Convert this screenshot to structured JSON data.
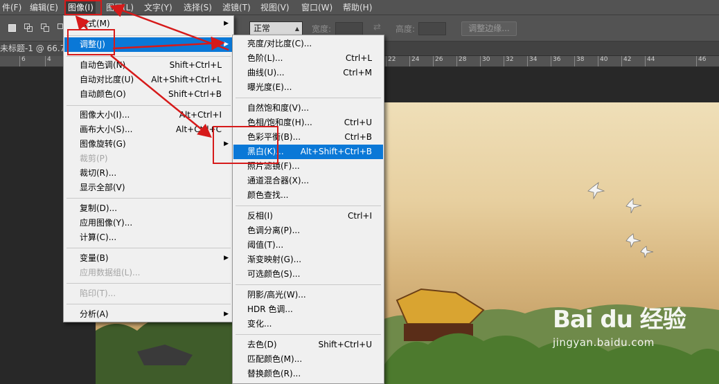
{
  "menubar": {
    "items": [
      "件(F)",
      "编辑(E)",
      "图像(I)",
      "图层(L)",
      "文字(Y)",
      "选择(S)",
      "滤镜(T)",
      "视图(V)",
      "窗口(W)",
      "帮助(H)"
    ]
  },
  "options": {
    "blend_mode": "正常",
    "width_label": "宽度:",
    "height_label": "高度:",
    "refine_edge": "调整边缘..."
  },
  "doc": {
    "tab": "未标题-1 @ 66.7%"
  },
  "ruler": {
    "labels": [
      "6",
      "4",
      "2",
      "22",
      "24",
      "26",
      "28",
      "30",
      "32",
      "34",
      "36",
      "38",
      "40",
      "42",
      "44",
      "46"
    ]
  },
  "image_menu": {
    "items": [
      {
        "label": "模式(M)",
        "shortcut": "",
        "submenu": true
      },
      {
        "label": "调整(J)",
        "shortcut": "",
        "submenu": true
      },
      {
        "label": "自动色调(N)",
        "shortcut": "Shift+Ctrl+L"
      },
      {
        "label": "自动对比度(U)",
        "shortcut": "Alt+Shift+Ctrl+L"
      },
      {
        "label": "自动颜色(O)",
        "shortcut": "Shift+Ctrl+B"
      },
      {
        "label": "图像大小(I)...",
        "shortcut": "Alt+Ctrl+I"
      },
      {
        "label": "画布大小(S)...",
        "shortcut": "Alt+Ctrl+C"
      },
      {
        "label": "图像旋转(G)",
        "shortcut": "",
        "submenu": true
      },
      {
        "label": "裁剪(P)",
        "shortcut": "",
        "disabled": true
      },
      {
        "label": "裁切(R)...",
        "shortcut": ""
      },
      {
        "label": "显示全部(V)",
        "shortcut": ""
      },
      {
        "label": "复制(D)...",
        "shortcut": ""
      },
      {
        "label": "应用图像(Y)...",
        "shortcut": ""
      },
      {
        "label": "计算(C)...",
        "shortcut": ""
      },
      {
        "label": "变量(B)",
        "shortcut": "",
        "submenu": true
      },
      {
        "label": "应用数据组(L)...",
        "shortcut": "",
        "disabled": true
      },
      {
        "label": "陷印(T)...",
        "shortcut": "",
        "disabled": true
      },
      {
        "label": "分析(A)",
        "shortcut": "",
        "submenu": true
      }
    ]
  },
  "adjust_menu": {
    "items": [
      {
        "label": "亮度/对比度(C)...",
        "shortcut": ""
      },
      {
        "label": "色阶(L)...",
        "shortcut": "Ctrl+L"
      },
      {
        "label": "曲线(U)...",
        "shortcut": "Ctrl+M"
      },
      {
        "label": "曝光度(E)...",
        "shortcut": ""
      },
      {
        "label": "自然饱和度(V)...",
        "shortcut": ""
      },
      {
        "label": "色相/饱和度(H)...",
        "shortcut": "Ctrl+U"
      },
      {
        "label": "色彩平衡(B)...",
        "shortcut": "Ctrl+B"
      },
      {
        "label": "黑白(K)...",
        "shortcut": "Alt+Shift+Ctrl+B"
      },
      {
        "label": "照片滤镜(F)...",
        "shortcut": ""
      },
      {
        "label": "通道混合器(X)...",
        "shortcut": ""
      },
      {
        "label": "颜色查找...",
        "shortcut": ""
      },
      {
        "label": "反相(I)",
        "shortcut": "Ctrl+I"
      },
      {
        "label": "色调分离(P)...",
        "shortcut": ""
      },
      {
        "label": "阈值(T)...",
        "shortcut": ""
      },
      {
        "label": "渐变映射(G)...",
        "shortcut": ""
      },
      {
        "label": "可选颜色(S)...",
        "shortcut": ""
      },
      {
        "label": "阴影/高光(W)...",
        "shortcut": ""
      },
      {
        "label": "HDR 色调...",
        "shortcut": ""
      },
      {
        "label": "变化...",
        "shortcut": ""
      },
      {
        "label": "去色(D)",
        "shortcut": "Shift+Ctrl+U"
      },
      {
        "label": "匹配颜色(M)...",
        "shortcut": ""
      },
      {
        "label": "替换颜色(R)...",
        "shortcut": ""
      }
    ]
  },
  "watermark": {
    "logo": "Bai du 经验",
    "url": "jingyan.baidu.com"
  },
  "colors": {
    "menu_highlight": "#0a78d7",
    "annotation": "#d61a1a",
    "chrome": "#535353"
  }
}
